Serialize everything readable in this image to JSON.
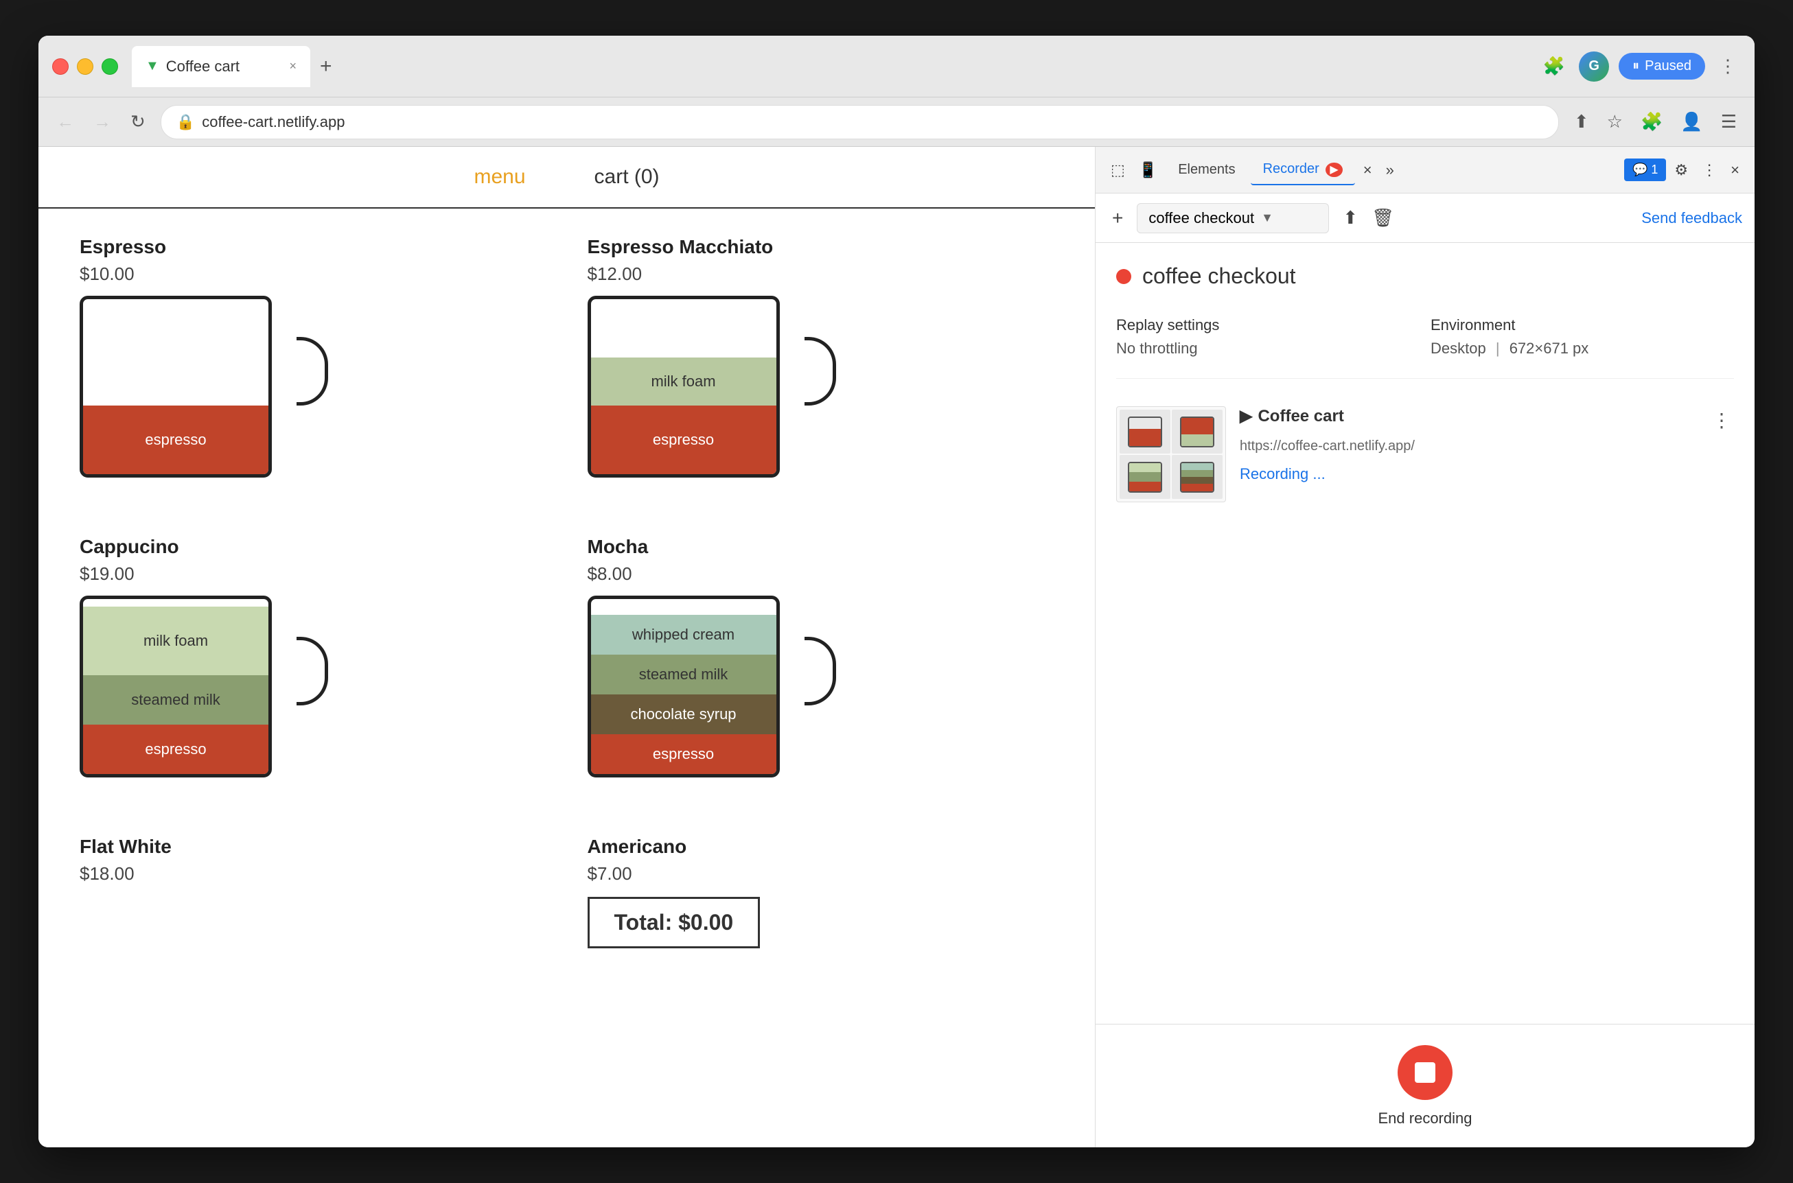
{
  "browser": {
    "tab_title": "Coffee cart",
    "tab_favicon": "▼",
    "url": "coffee-cart.netlify.app",
    "close_label": "×",
    "new_tab_label": "+",
    "paused_label": "Paused"
  },
  "nav": {
    "menu_label": "menu",
    "cart_label": "cart (0)"
  },
  "products": [
    {
      "id": "espresso",
      "name": "Espresso",
      "price": "$10.00",
      "layers": [
        {
          "name": "espresso",
          "color": "#c0442a",
          "text_color": "white",
          "height": 100
        }
      ]
    },
    {
      "id": "espresso-macchiato",
      "name": "Espresso Macchiato",
      "price": "$12.00",
      "layers": [
        {
          "name": "espresso",
          "color": "#c0442a",
          "text_color": "white",
          "height": 100
        },
        {
          "name": "milk foam",
          "color": "#b8c9a0",
          "text_color": "#333",
          "height": 70
        }
      ]
    },
    {
      "id": "cappucino",
      "name": "Cappucino",
      "price": "$19.00",
      "layers": [
        {
          "name": "espresso",
          "color": "#c0442a",
          "text_color": "white",
          "height": 72
        },
        {
          "name": "steamed milk",
          "color": "#8a9e70",
          "text_color": "#333",
          "height": 72
        },
        {
          "name": "milk foam",
          "color": "#c8d9b0",
          "text_color": "#333",
          "height": 100
        }
      ]
    },
    {
      "id": "mocha",
      "name": "Mocha",
      "price": "$8.00",
      "layers": [
        {
          "name": "espresso",
          "color": "#c0442a",
          "text_color": "white",
          "height": 60
        },
        {
          "name": "chocolate syrup",
          "color": "#6b5a3a",
          "text_color": "white",
          "height": 60
        },
        {
          "name": "steamed milk",
          "color": "#8a9e70",
          "text_color": "#333",
          "height": 60
        },
        {
          "name": "whipped cream",
          "color": "#a8c9b8",
          "text_color": "#333",
          "height": 60
        }
      ]
    },
    {
      "id": "flat-white",
      "name": "Flat White",
      "price": "$18.00"
    },
    {
      "id": "americano",
      "name": "Americano",
      "price": "$7.00"
    }
  ],
  "total": {
    "label": "Total: $0.00"
  },
  "devtools": {
    "tabs": [
      "Elements",
      "Recorder",
      "more"
    ],
    "recorder_tab": "Recorder",
    "add_label": "+",
    "recording_select": "coffee checkout",
    "send_feedback": "Send feedback",
    "recording_title": "coffee checkout",
    "replay_settings": {
      "label": "Replay settings",
      "throttle_label": "No throttling",
      "environment_label": "Environment",
      "environment_value": "Desktop",
      "resolution": "672×671 px"
    },
    "recording_entry": {
      "site_name": "Coffee cart",
      "url": "https://coffee-cart.netlify.app/",
      "status": "Recording ..."
    },
    "end_recording_label": "End recording"
  }
}
